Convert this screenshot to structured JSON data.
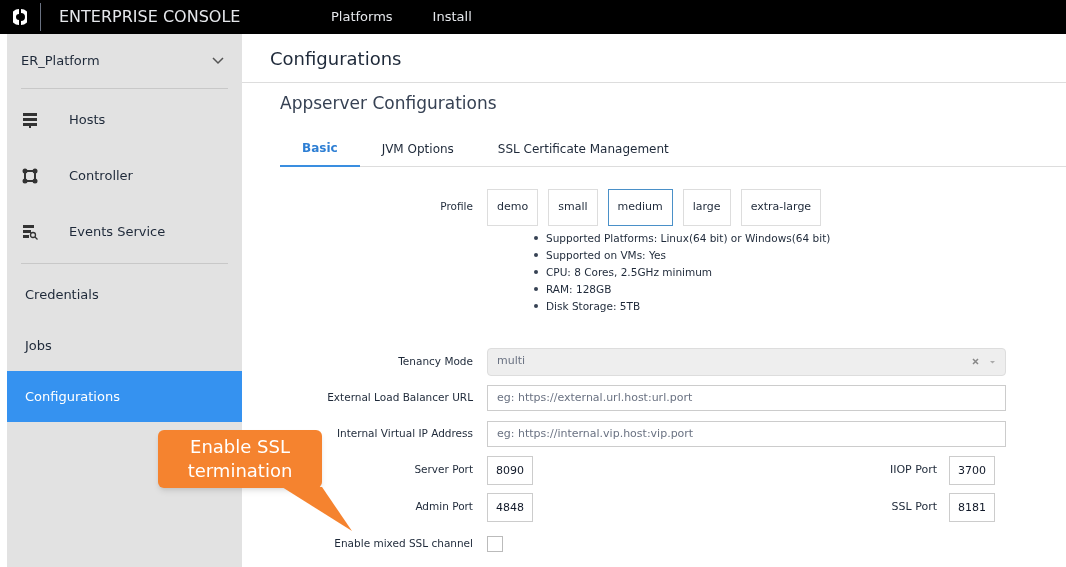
{
  "top_bar": {
    "title": "ENTERPRISE CONSOLE",
    "nav": [
      "Platforms",
      "Install"
    ]
  },
  "sidebar": {
    "platform": "ER_Platform",
    "groups": [
      {
        "items": [
          {
            "label": "Hosts",
            "selected": false
          },
          {
            "label": "Controller",
            "selected": false
          },
          {
            "label": "Events Service",
            "selected": false
          }
        ]
      },
      {
        "items": [
          {
            "label": "Credentials",
            "selected": false
          },
          {
            "label": "Jobs",
            "selected": false
          },
          {
            "label": "Configurations",
            "selected": true
          }
        ]
      }
    ]
  },
  "page_title": "Configurations",
  "section_title": "Appserver Configurations",
  "tabs": [
    {
      "label": "Basic",
      "selected": true
    },
    {
      "label": "JVM Options",
      "selected": false
    },
    {
      "label": "SSL Certificate Management",
      "selected": false
    }
  ],
  "profile": {
    "label": "Profile",
    "options": [
      {
        "label": "demo",
        "selected": false
      },
      {
        "label": "small",
        "selected": false
      },
      {
        "label": "medium",
        "selected": true
      },
      {
        "label": "large",
        "selected": false
      },
      {
        "label": "extra-large",
        "selected": false
      }
    ],
    "details": [
      "Supported Platforms: Linux(64 bit) or Windows(64 bit)",
      "Supported on VMs: Yes",
      "CPU: 8 Cores, 2.5GHz minimum",
      "RAM: 128GB",
      "Disk Storage: 5TB"
    ]
  },
  "form": [
    {
      "kind": "select",
      "label": "Tenancy Mode",
      "value": "multi",
      "disabled": true
    },
    {
      "kind": "text",
      "label": "External Load Balancer URL",
      "placeholder": "eg: https://external.url.host:url.port"
    },
    {
      "kind": "text",
      "label": "Internal Virtual IP Address",
      "placeholder": "eg: https://internal.vip.host:vip.port"
    },
    {
      "kind": "ports",
      "label": "Server Port",
      "value": "8090",
      "label_2": "IIOP Port",
      "value_2": "3700"
    },
    {
      "kind": "ports",
      "label": "Admin Port",
      "value": "4848",
      "label_2": "SSL Port",
      "value_2": "8181"
    },
    {
      "kind": "checkbox",
      "label": "Enable mixed SSL channel",
      "checked": false
    }
  ],
  "callout": {
    "text": "Enable SSL termination"
  }
}
